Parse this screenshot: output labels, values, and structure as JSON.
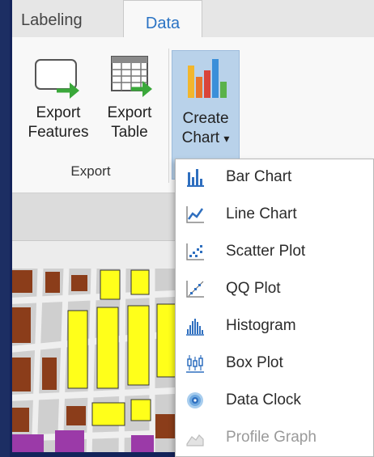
{
  "tabs": [
    {
      "label": "Labeling",
      "active": false
    },
    {
      "label": "Data",
      "active": true
    }
  ],
  "ribbon": {
    "export_features": {
      "line1": "Export",
      "line2": "Features"
    },
    "export_table": {
      "line1": "Export",
      "line2": "Table"
    },
    "group_label": "Export",
    "create_chart": {
      "line1": "Create",
      "line2": "Chart",
      "dropdown": "▾"
    }
  },
  "chart_menu": {
    "items": [
      {
        "label": "Bar Chart",
        "icon": "bar-chart-icon",
        "enabled": true
      },
      {
        "label": "Line Chart",
        "icon": "line-chart-icon",
        "enabled": true
      },
      {
        "label": "Scatter Plot",
        "icon": "scatter-plot-icon",
        "enabled": true
      },
      {
        "label": "QQ Plot",
        "icon": "qq-plot-icon",
        "enabled": true
      },
      {
        "label": "Histogram",
        "icon": "histogram-icon",
        "enabled": true
      },
      {
        "label": "Box Plot",
        "icon": "box-plot-icon",
        "enabled": true
      },
      {
        "label": "Data Clock",
        "icon": "data-clock-icon",
        "enabled": true
      },
      {
        "label": "Profile Graph",
        "icon": "profile-graph-icon",
        "enabled": false
      }
    ]
  },
  "colors": {
    "accent_blue": "#2a73c4",
    "selected_button": "#b9d2ea",
    "icon_blue": "#2f6fbf",
    "arrow_green": "#3aa83a",
    "map_yellow": "#ffff1a",
    "map_brown": "#8b3d1a",
    "map_purple": "#9b3aa8",
    "background_navy": "#1c2e63"
  }
}
